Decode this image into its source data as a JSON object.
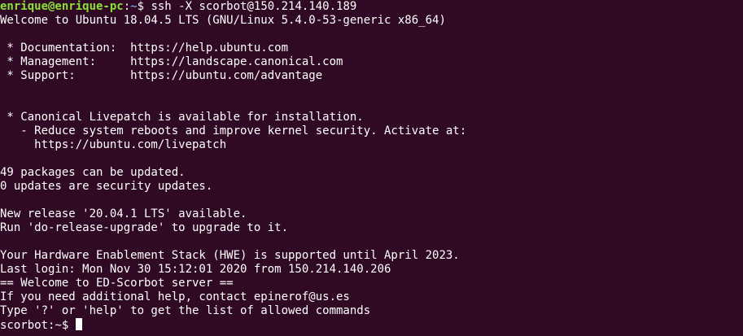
{
  "prompt": {
    "user_host": "enrique@enrique-pc",
    "colon": ":",
    "path": "~",
    "symbol": "$ ",
    "command": "ssh -X scorbot@150.214.140.189"
  },
  "output": [
    "Welcome to Ubuntu 18.04.5 LTS (GNU/Linux 5.4.0-53-generic x86_64)",
    "",
    " * Documentation:  https://help.ubuntu.com",
    " * Management:     https://landscape.canonical.com",
    " * Support:        https://ubuntu.com/advantage",
    "",
    "",
    " * Canonical Livepatch is available for installation.",
    "   - Reduce system reboots and improve kernel security. Activate at:",
    "     https://ubuntu.com/livepatch",
    "",
    "49 packages can be updated.",
    "0 updates are security updates.",
    "",
    "New release '20.04.1 LTS' available.",
    "Run 'do-release-upgrade' to upgrade to it.",
    "",
    "Your Hardware Enablement Stack (HWE) is supported until April 2023.",
    "Last login: Mon Nov 30 15:12:01 2020 from 150.214.140.206",
    "== Welcome to ED-Scorbot server ==",
    "If you need additional help, contact epinerof@us.es",
    "Type '?' or 'help' to get the list of allowed commands"
  ],
  "remote_prompt": "scorbot:~$ ",
  "colors": {
    "background": "#300a24",
    "foreground": "#ffffff",
    "user_host": "#8ae234",
    "path": "#729fcf"
  }
}
